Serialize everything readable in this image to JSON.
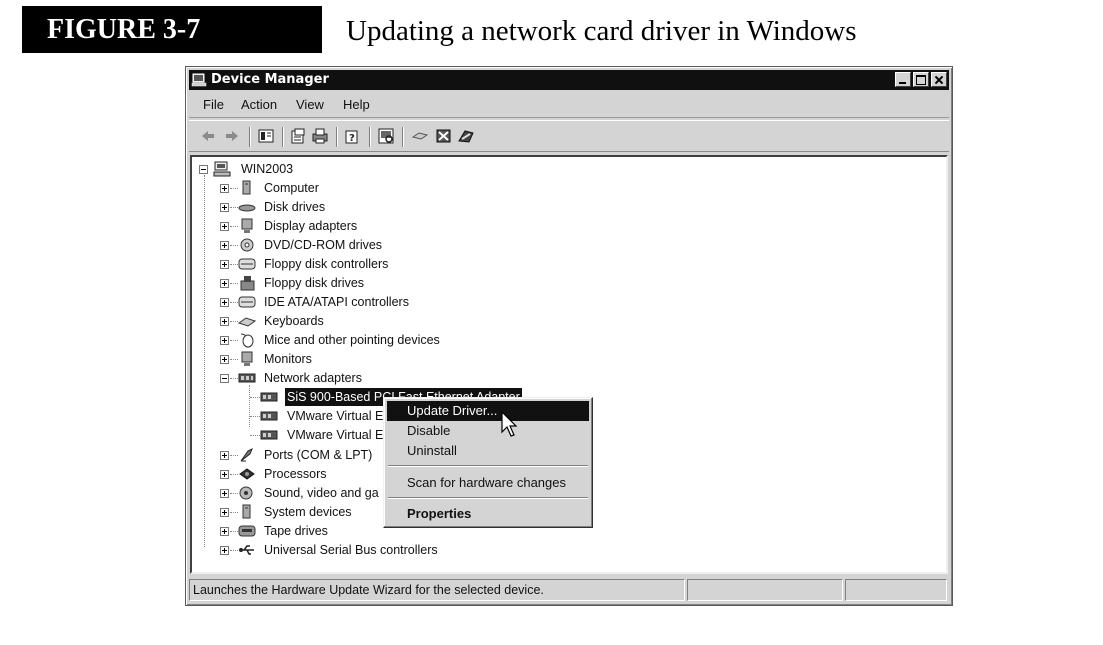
{
  "figure": {
    "label": "FIGURE 3-7",
    "title": "Updating a network card driver in Windows"
  },
  "window": {
    "title": "Device Manager"
  },
  "menu": {
    "file": "File",
    "action": "Action",
    "view": "View",
    "help": "Help"
  },
  "toolbar_icons": [
    "back-arrow-icon",
    "forward-arrow-icon",
    "show-hide-console-tree-icon",
    "properties-icon",
    "print-icon",
    "help-icon",
    "scan-hardware-icon",
    "update-driver-icon",
    "disable-device-icon",
    "uninstall-device-icon"
  ],
  "tree": {
    "root": "WIN2003",
    "categories": [
      "Computer",
      "Disk drives",
      "Display adapters",
      "DVD/CD-ROM drives",
      "Floppy disk controllers",
      "Floppy disk drives",
      "IDE ATA/ATAPI controllers",
      "Keyboards",
      "Mice and other pointing devices",
      "Monitors",
      "Network adapters",
      "Ports (COM & LPT)",
      "Processors",
      "Sound, video and ga",
      "System devices",
      "Tape drives",
      "Universal Serial Bus controllers"
    ],
    "network_children": [
      "SiS 900-Based PCI Fast Ethernet Adapter",
      "VMware Virtual E",
      "VMware Virtual E"
    ]
  },
  "context_menu": {
    "items": [
      "Update Driver...",
      "Disable",
      "Uninstall",
      "Scan for hardware changes",
      "Properties"
    ]
  },
  "statusbar": {
    "text": "Launches the Hardware Update Wizard for the selected device."
  }
}
